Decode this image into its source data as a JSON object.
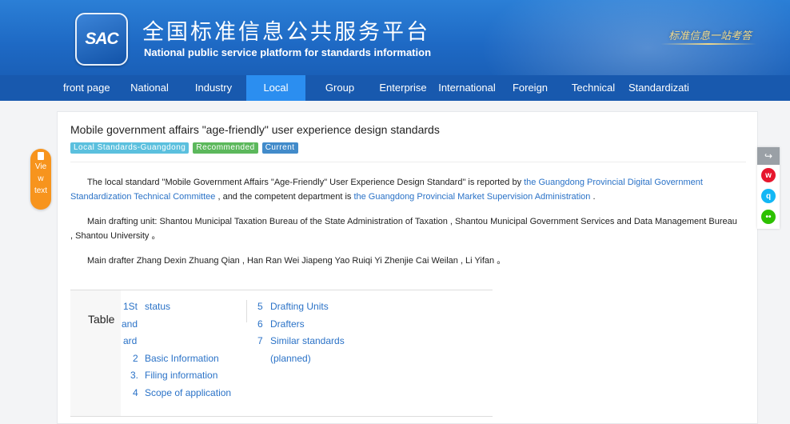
{
  "header": {
    "logo_text": "SAC",
    "title_cn": "全国标准信息公共服务平台",
    "title_en": "National public service platform  for standards information",
    "slogan": "标准信息一站考答"
  },
  "nav": {
    "items": [
      {
        "label": "front page"
      },
      {
        "label": "National"
      },
      {
        "label": "Industry"
      },
      {
        "label": "Local",
        "active": true
      },
      {
        "label": "Group"
      },
      {
        "label": "Enterprise"
      },
      {
        "label": "International"
      },
      {
        "label": "Foreign"
      },
      {
        "label": "Technical"
      },
      {
        "label": "Standardizati"
      }
    ]
  },
  "standard": {
    "title": "Mobile government affairs \"age-friendly\" user experience design standards",
    "tags": {
      "local": "Local Standards-Guangdong",
      "recommended": "Recommended",
      "current": "Current"
    },
    "intro": {
      "text1": "The local standard \"Mobile Government Affairs \"Age-Friendly\" User Experience Design Standard\" is reported by ",
      "link1": "the Guangdong Provincial Digital Government Standardization Technical Committee",
      "text2": " , and the competent department is ",
      "link2": "the Guangdong Provincial Market Supervision Administration",
      "text3": " ."
    },
    "drafting_unit": "Main drafting unit: Shantou Municipal Taxation Bureau of the State Administration of Taxation , Shantou Municipal Government Services and Data Management Bureau , Shantou University 。",
    "drafter": "Main drafter Zhang Dexin Zhuang Qian , Han Ran Wei Jiapeng Yao Ruiqi Yi Zhenjie Cai Weilan , Li Yifan 。"
  },
  "toc": {
    "label": "Table",
    "col1": [
      {
        "num": "1St",
        "text": "status"
      },
      {
        "num": "and",
        "text": ""
      },
      {
        "num": "ard",
        "text": ""
      },
      {
        "num": "2",
        "text": "Basic Information"
      },
      {
        "num": "3.",
        "text": "Filing information"
      },
      {
        "num": "4",
        "text": "Scope of application"
      }
    ],
    "col2": [
      {
        "num": "5",
        "text": "Drafting Units"
      },
      {
        "num": "6",
        "text": "Drafters"
      },
      {
        "num": "7",
        "text": "Similar standards"
      },
      {
        "num": "",
        "text": "(planned)"
      }
    ]
  },
  "view_text": {
    "line1": "Vie",
    "line2": "w",
    "line3": "text"
  },
  "colors": {
    "header_blue": "#1e69c4",
    "nav_blue": "#1859ae",
    "nav_active": "#2b8ef0",
    "link": "#2a72c7",
    "view_button": "#f7941d"
  },
  "share_icons": [
    "share-icon",
    "weibo-icon",
    "qq-icon",
    "wechat-icon"
  ]
}
